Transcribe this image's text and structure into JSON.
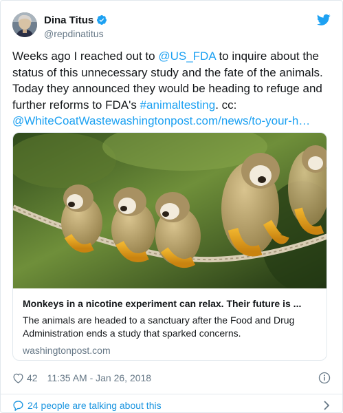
{
  "author": {
    "display_name": "Dina Titus",
    "handle": "@repdinatitus",
    "verified": true,
    "avatar_icon": "profile-photo"
  },
  "icons": {
    "verified": "verified-badge-icon",
    "brand": "twitter-bird-icon",
    "like": "heart-icon",
    "info": "info-icon",
    "reply": "speech-bubble-icon",
    "more": "chevron-right-icon"
  },
  "tweet": {
    "text_parts": [
      "Weeks ago I reached out to ",
      "@US_FDA",
      " to inquire about the status of this unnecessary study and the fate of the animals. Today they announced they would be heading to refuge and further reforms to FDA's ",
      "#animaltesting",
      ". cc: ",
      "@WhiteCoatWastewashingtonpost.com/news/to-your-h…"
    ]
  },
  "card": {
    "title": "Monkeys in a nicotine experiment can relax. Their future is ...",
    "description": "The animals are headed to a sanctuary after the Food and Drug Administration ends a study that sparked concerns.",
    "domain": "washingtonpost.com"
  },
  "meta": {
    "likes": "42",
    "timestamp": "11:35 AM - Jan 26, 2018"
  },
  "footer": {
    "talking_text": "24 people are talking about this"
  },
  "colors": {
    "link": "#1da1f2",
    "secondary_text": "#657786",
    "border": "#e1e8ed"
  }
}
